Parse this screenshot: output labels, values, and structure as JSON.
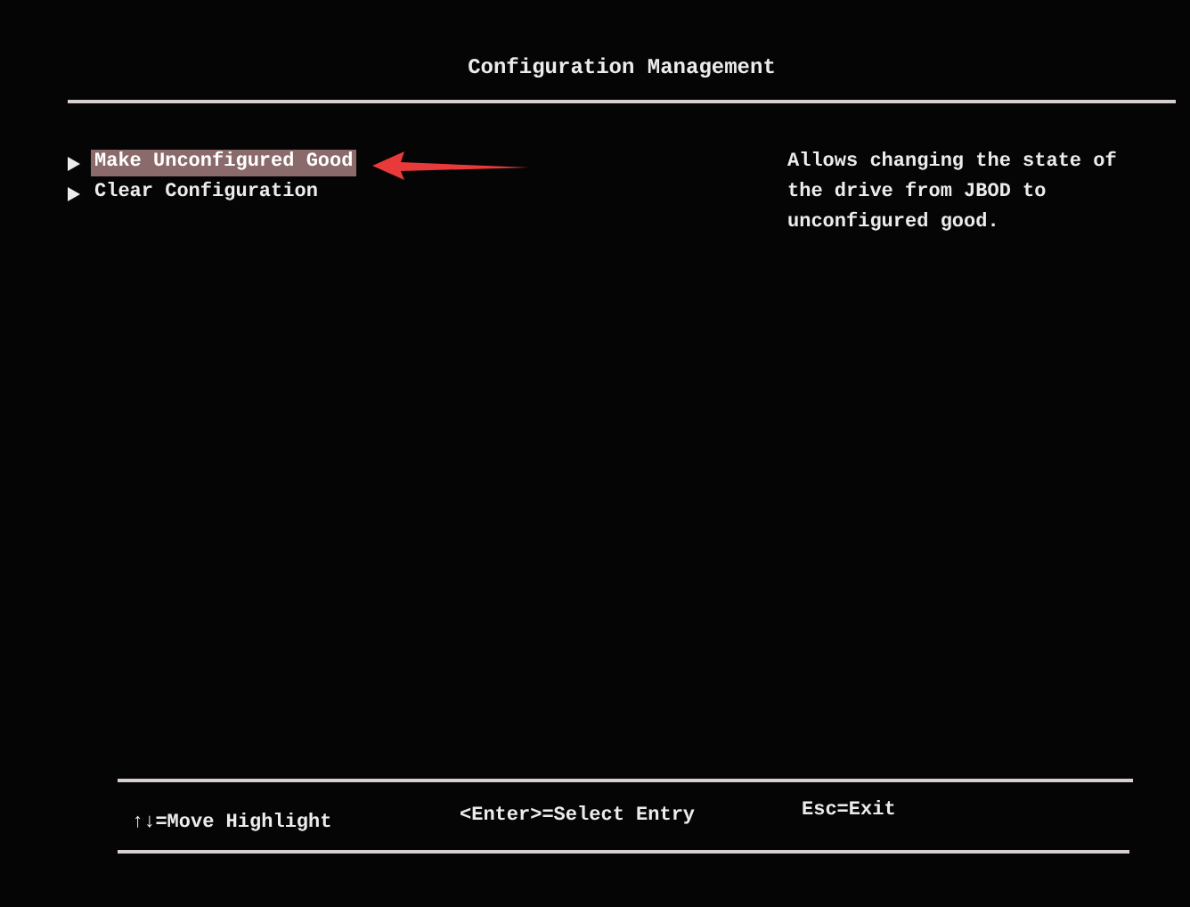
{
  "title": "Configuration Management",
  "menu": [
    {
      "label": "Make Unconfigured Good",
      "selected": true
    },
    {
      "label": "Clear Configuration",
      "selected": false
    }
  ],
  "help": "Allows changing the state of the drive from JBOD to unconfigured good.",
  "hints": [
    "↑↓=Move Highlight",
    "<Enter>=Select Entry",
    "Esc=Exit"
  ]
}
